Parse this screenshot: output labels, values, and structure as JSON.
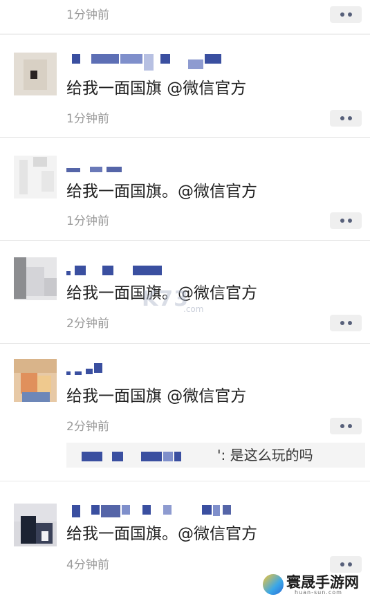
{
  "comments": [
    {
      "time": "1分钟前"
    },
    {
      "message": "给我一面国旗 @微信官方",
      "time": "1分钟前"
    },
    {
      "message": "给我一面国旗。@微信官方",
      "time": "1分钟前"
    },
    {
      "message": "给我一面国旗。@微信官方",
      "time": "2分钟前"
    },
    {
      "message": "给我一面国旗 @微信官方",
      "time": "2分钟前",
      "reply": {
        "text": "': 是这么玩的吗"
      }
    },
    {
      "message": "给我一面国旗。@微信官方",
      "time": "4分钟前"
    }
  ],
  "icons": {
    "more": "more-dots-icon"
  },
  "watermarks": {
    "center": "K73",
    "center_sub": ".com",
    "site_title": "寰晟手游网",
    "site_sub": "huan-sun.com"
  },
  "colors": {
    "more_dot": "#57607a",
    "time_text": "#9a9a9a"
  }
}
